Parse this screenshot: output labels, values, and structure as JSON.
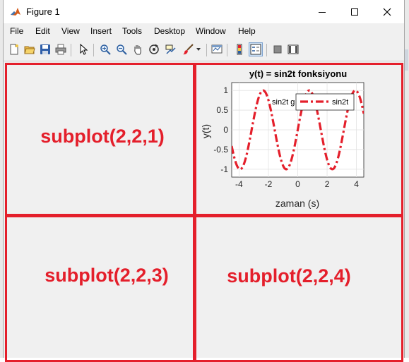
{
  "window": {
    "title": "Figure 1"
  },
  "menu": [
    "File",
    "Edit",
    "View",
    "Insert",
    "Tools",
    "Desktop",
    "Window",
    "Help"
  ],
  "toolbar": {
    "icons": [
      "new-figure-icon",
      "open-file-icon",
      "save-icon",
      "print-icon",
      "pointer-icon",
      "zoom-in-icon",
      "zoom-out-icon",
      "pan-icon",
      "rotate-3d-icon",
      "data-cursor-icon",
      "brush-icon",
      "link-plot-icon",
      "colorbar-icon",
      "legend-icon",
      "hide-plot-tools-icon",
      "show-plot-tools-icon"
    ]
  },
  "subplots": {
    "sp1": "subplot(2,2,1)",
    "sp3": "subplot(2,2,3)",
    "sp4": "subplot(2,2,4)"
  },
  "chart_data": {
    "type": "line",
    "title": "y(t) = sin2t fonksiyonu",
    "xlabel": "zaman (s)",
    "ylabel": "y(t)",
    "xlim": [
      -4.5,
      4.5
    ],
    "ylim": [
      -1.2,
      1.2
    ],
    "xticks": [
      "-4",
      "-2",
      "0",
      "2",
      "4"
    ],
    "yticks": [
      "1",
      "0.5",
      "0",
      "-0.5",
      "-1"
    ],
    "grid": true,
    "series": [
      {
        "name": "sin2t",
        "function": "sin(2t)",
        "color": "#e41f2b",
        "linestyle": "dash-dot"
      }
    ],
    "annotation": "sin2t g",
    "legend": {
      "position": "top-right",
      "entry": "sin2t"
    }
  },
  "colors": {
    "accent": "#e41f2b",
    "figure_bg": "#f0f0f0"
  }
}
